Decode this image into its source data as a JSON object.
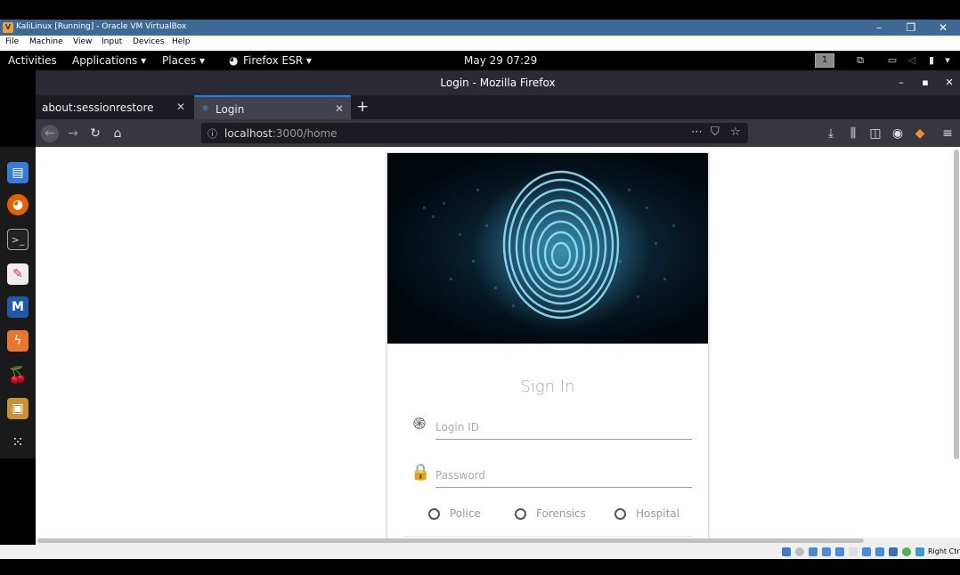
{
  "vbox": {
    "title": "KaliLinux [Running] - Oracle VM VirtualBox",
    "menu": [
      "File",
      "Machine",
      "View",
      "Input",
      "Devices",
      "Help"
    ],
    "host_key": "Right Ctrl"
  },
  "gnome": {
    "activities": "Activities",
    "applications": "Applications ▾",
    "places": "Places ▾",
    "app": "Firefox ESR ▾",
    "clock": "May 29  07:29",
    "workspace": "1"
  },
  "firefox": {
    "window_title": "Login - Mozilla Firefox",
    "tabs": [
      {
        "label": "about:sessionrestore"
      },
      {
        "label": "Login"
      }
    ],
    "url_host": "localhost",
    "url_rest": ":3000/home"
  },
  "login": {
    "title": "Sign In",
    "login_placeholder": "Login ID",
    "password_placeholder": "Password",
    "roles": [
      "Police",
      "Forensics",
      "Hospital"
    ]
  }
}
